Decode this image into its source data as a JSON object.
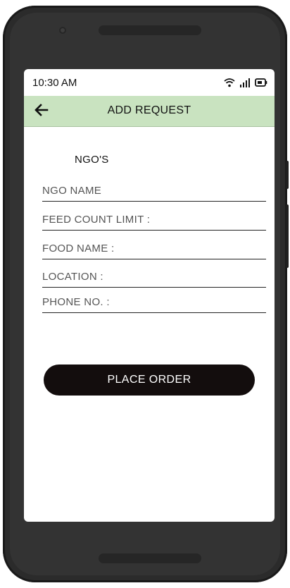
{
  "status_bar": {
    "time": "10:30 AM",
    "icons": [
      "wifi-icon",
      "signal-icon",
      "battery-icon"
    ]
  },
  "app_bar": {
    "title": "ADD REQUEST",
    "back_icon": "arrow-left-icon",
    "background": "#c9e3c0"
  },
  "form": {
    "section_title": "NGO'S",
    "fields": [
      {
        "label": "NGO NAME"
      },
      {
        "label": "FEED COUNT LIMIT :"
      },
      {
        "label": "FOOD NAME :"
      },
      {
        "label": "LOCATION :"
      },
      {
        "label": "PHONE NO. :"
      }
    ],
    "submit_label": "PLACE ORDER"
  },
  "colors": {
    "button": "#130d0d",
    "device": "#2b2b2b"
  }
}
